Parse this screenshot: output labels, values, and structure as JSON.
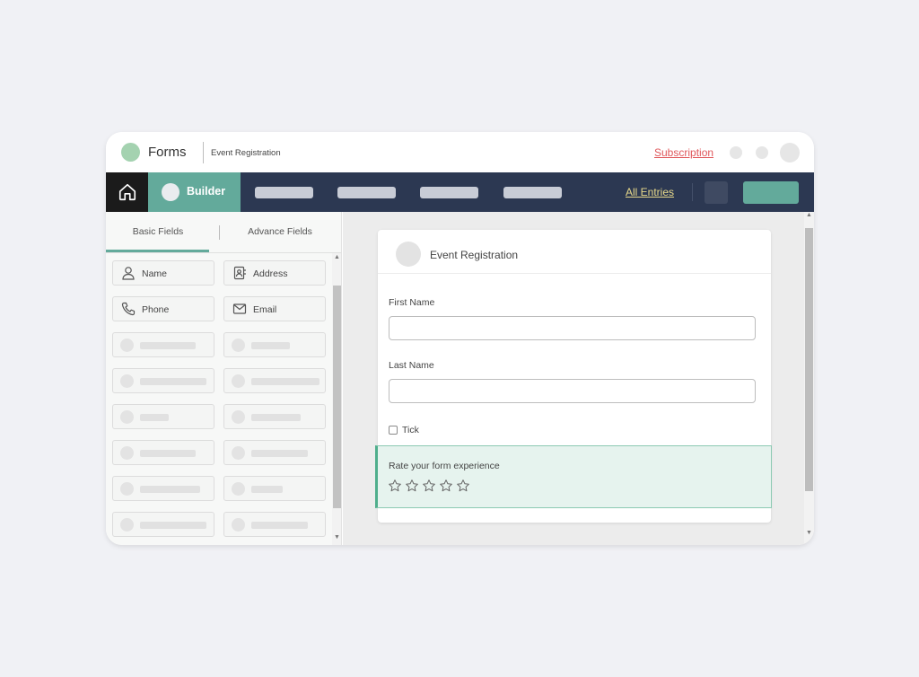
{
  "titlebar": {
    "app_title": "Forms",
    "form_name": "Event Registration",
    "subscription_link": "Subscription"
  },
  "nav": {
    "builder_label": "Builder",
    "all_entries_link": "All Entries",
    "icons": {
      "home": "home-icon"
    }
  },
  "sidebar": {
    "tabs": [
      {
        "label": "Basic Fields",
        "active": true
      },
      {
        "label": "Advance Fields",
        "active": false
      }
    ],
    "fields": [
      {
        "label": "Name",
        "icon": "user-icon"
      },
      {
        "label": "Address",
        "icon": "address-book-icon"
      },
      {
        "label": "Phone",
        "icon": "phone-icon"
      },
      {
        "label": "Email",
        "icon": "envelope-icon"
      }
    ]
  },
  "form": {
    "header_title": "Event Registration",
    "first_name_label": "First Name",
    "first_name_value": "",
    "last_name_label": "Last Name",
    "last_name_value": "",
    "checkbox_label": "Tick",
    "checkbox_checked": false,
    "rating_label": "Rate your form experience",
    "rating_max": 5,
    "rating_value": 0
  },
  "colors": {
    "accent": "#63aa9b",
    "nav_bg": "#2c3852",
    "subscription": "#e0575b",
    "all_entries": "#e8d98a",
    "rating_bg": "#e6f3ee",
    "rating_border": "#4fae8c"
  }
}
